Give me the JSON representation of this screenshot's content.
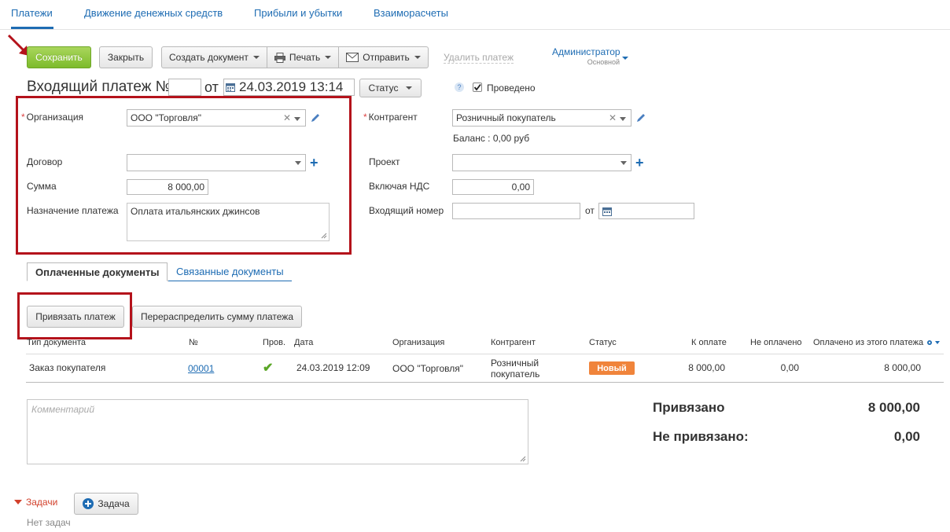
{
  "tabs": [
    "Платежи",
    "Движение денежных средств",
    "Прибыли и убытки",
    "Взаиморасчеты"
  ],
  "toolbar": {
    "save": "Сохранить",
    "close": "Закрыть",
    "create_doc": "Создать документ",
    "print": "Печать",
    "send": "Отправить",
    "delete": "Удалить платеж"
  },
  "user": {
    "name": "Администратор",
    "role": "Основной"
  },
  "header": {
    "title": "Входящий платеж №",
    "number": "",
    "from": "от",
    "date": "24.03.2019 13:14",
    "status_button": "Статус",
    "help": "?",
    "posted_label": "Проведено",
    "posted": true
  },
  "form": {
    "org_label": "Организация",
    "org_value": "ООО \"Торговля\"",
    "contract_label": "Договор",
    "contract_value": "",
    "sum_label": "Сумма",
    "sum_value": "8 000,00",
    "purpose_label": "Назначение платежа",
    "purpose_value": "Оплата итальянских джинсов",
    "counterparty_label": "Контрагент",
    "counterparty_value": "Розничный покупатель",
    "balance": "Баланс : 0,00 руб",
    "project_label": "Проект",
    "project_value": "",
    "vat_label": "Включая НДС",
    "vat_value": "0,00",
    "in_number_label": "Входящий номер",
    "in_number_value": "",
    "in_from": "от",
    "in_date": ""
  },
  "subtabs": [
    "Оплаченные документы",
    "Связанные документы"
  ],
  "actions": {
    "bind": "Привязать платеж",
    "redistribute": "Перераспределить сумму платежа"
  },
  "table": {
    "headers": [
      "Тип документа",
      "№",
      "Пров.",
      "Дата",
      "Организация",
      "Контрагент",
      "Статус",
      "К оплате",
      "Не оплачено",
      "Оплачено из этого платежа"
    ],
    "rows": [
      {
        "type": "Заказ покупателя",
        "number": "00001",
        "posted": "✔",
        "date": "24.03.2019 12:09",
        "org": "ООО \"Торговля\"",
        "counterparty_line1": "Розничный",
        "counterparty_line2": "покупатель",
        "status": "Новый",
        "to_pay": "8 000,00",
        "unpaid": "0,00",
        "paid": "8 000,00"
      }
    ]
  },
  "comment_placeholder": "Комментарий",
  "summary": {
    "bound_label": "Привязано",
    "bound_value": "8 000,00",
    "unbound_label": "Не привязано:",
    "unbound_value": "0,00"
  },
  "tasks": {
    "label": "Задачи",
    "add": "Задача",
    "empty": "Нет задач"
  },
  "colors": {
    "accent": "#1e6cb3",
    "save_green": "#7dbb2b",
    "highlight_red": "#b4121b",
    "badge_orange": "#f0843b"
  }
}
